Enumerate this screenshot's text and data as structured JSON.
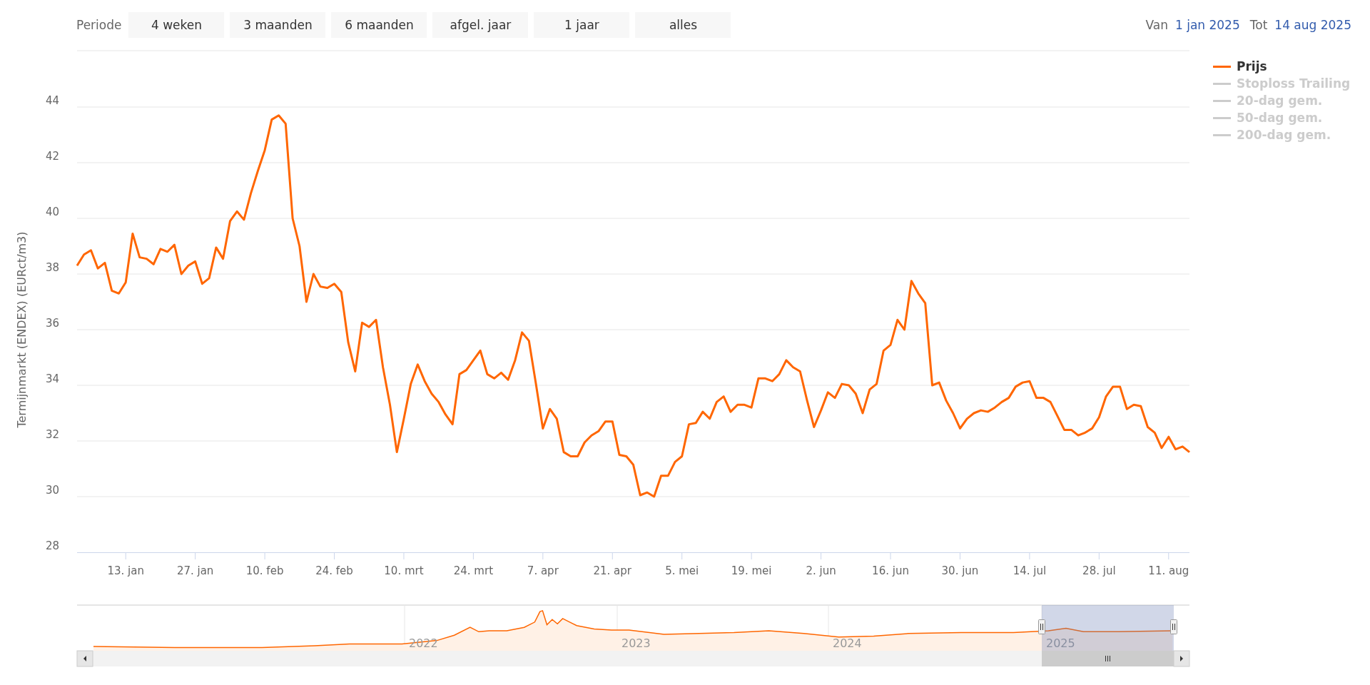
{
  "range_selector": {
    "label": "Periode",
    "buttons": [
      {
        "label": "4 weken",
        "selected": false
      },
      {
        "label": "3 maanden",
        "selected": false
      },
      {
        "label": "6 maanden",
        "selected": false
      },
      {
        "label": "afgel. jaar",
        "selected": false
      },
      {
        "label": "1 jaar",
        "selected": false
      },
      {
        "label": "alles",
        "selected": false
      }
    ]
  },
  "date_range": {
    "from_label": "Van",
    "from": "1 jan 2025",
    "to_label": "Tot",
    "to": "14 aug 2025"
  },
  "hidden_series_legend": [
    {
      "name": "Stoploss Trailing",
      "visible": false
    },
    {
      "name": "20-dag gem.",
      "visible": false
    },
    {
      "name": "50-dag gem.",
      "visible": false
    },
    {
      "name": "200-dag gem.",
      "visible": false
    }
  ],
  "chart_data": {
    "type": "line",
    "grid": true,
    "ylabel": "Termijnmarkt (ENDEX) (EURct/m3)",
    "ylim": [
      28,
      46
    ],
    "yticks": [
      28,
      30,
      32,
      34,
      36,
      38,
      40,
      42,
      44
    ],
    "categories": [
      null,
      null,
      null,
      null,
      null,
      null,
      null,
      "13. jan",
      null,
      null,
      null,
      null,
      null,
      null,
      null,
      null,
      null,
      "27. jan",
      null,
      null,
      null,
      null,
      null,
      null,
      null,
      null,
      null,
      "10. feb",
      null,
      null,
      null,
      null,
      null,
      null,
      null,
      null,
      null,
      "24. feb",
      null,
      null,
      null,
      null,
      null,
      null,
      null,
      null,
      null,
      "10. mrt",
      null,
      null,
      null,
      null,
      null,
      null,
      null,
      null,
      null,
      "24. mrt",
      null,
      null,
      null,
      null,
      null,
      null,
      null,
      null,
      null,
      "7. apr",
      null,
      null,
      null,
      null,
      null,
      null,
      null,
      null,
      null,
      "21. apr",
      null,
      null,
      null,
      null,
      null,
      null,
      null,
      null,
      null,
      "5. mei",
      null,
      null,
      null,
      null,
      null,
      null,
      null,
      null,
      null,
      "19. mei",
      null,
      null,
      null,
      null,
      null,
      null,
      null,
      null,
      null,
      "2. jun",
      null,
      null,
      null,
      null,
      null,
      null,
      null,
      null,
      null,
      "16. jun",
      null,
      null,
      null,
      null,
      null,
      null,
      null,
      null,
      null,
      "30. jun",
      null,
      null,
      null,
      null,
      null,
      null,
      null,
      null,
      null,
      "14. jul",
      null,
      null,
      null,
      null,
      null,
      null,
      null,
      null,
      null,
      "28. jul",
      null,
      null,
      null,
      null,
      null,
      null,
      null,
      null,
      null,
      "11. aug",
      null,
      null,
      null
    ],
    "series": [
      {
        "name": "Prijs",
        "color": "#ff6600",
        "values": [
          38.3,
          38.7,
          38.85,
          38.2,
          38.4,
          37.4,
          37.3,
          37.7,
          39.45,
          38.6,
          38.55,
          38.35,
          38.9,
          38.8,
          39.05,
          38.0,
          38.3,
          38.45,
          37.65,
          37.85,
          38.95,
          38.55,
          39.9,
          40.25,
          39.95,
          40.9,
          41.7,
          42.45,
          43.55,
          43.7,
          43.4,
          40.0,
          39.0,
          37.0,
          38.0,
          37.55,
          37.5,
          37.65,
          37.35,
          35.55,
          34.5,
          36.25,
          36.1,
          36.35,
          34.65,
          33.3,
          31.6,
          32.8,
          34.05,
          34.75,
          34.15,
          33.7,
          33.4,
          32.95,
          32.6,
          34.4,
          34.55,
          34.9,
          35.25,
          34.4,
          34.25,
          34.45,
          34.2,
          34.9,
          35.9,
          35.6,
          34.05,
          32.45,
          33.15,
          32.8,
          31.6,
          31.45,
          31.45,
          31.95,
          32.2,
          32.35,
          32.7,
          32.7,
          31.5,
          31.45,
          31.15,
          30.05,
          30.15,
          30.0,
          30.75,
          30.75,
          31.25,
          31.45,
          32.6,
          32.65,
          33.05,
          32.8,
          33.4,
          33.6,
          33.05,
          33.3,
          33.3,
          33.2,
          34.25,
          34.25,
          34.15,
          34.4,
          34.9,
          34.65,
          34.5,
          33.45,
          32.5,
          33.1,
          33.75,
          33.55,
          34.05,
          34.0,
          33.7,
          33.0,
          33.85,
          34.05,
          35.25,
          35.45,
          36.35,
          36.0,
          37.75,
          37.3,
          36.95,
          34.0,
          34.1,
          33.45,
          33.0,
          32.45,
          32.8,
          33.0,
          33.1,
          33.05,
          33.2,
          33.4,
          33.55,
          33.95,
          34.1,
          34.15,
          33.55,
          33.55,
          33.4,
          32.9,
          32.4,
          32.4,
          32.2,
          32.3,
          32.45,
          32.85,
          33.6,
          33.95,
          33.95,
          33.15,
          33.3,
          33.25,
          32.5,
          32.3,
          31.75,
          32.15,
          31.7,
          31.8,
          31.6
        ]
      }
    ]
  },
  "navigator": {
    "year_labels": [
      "2022",
      "2023",
      "2024",
      "2025"
    ]
  }
}
